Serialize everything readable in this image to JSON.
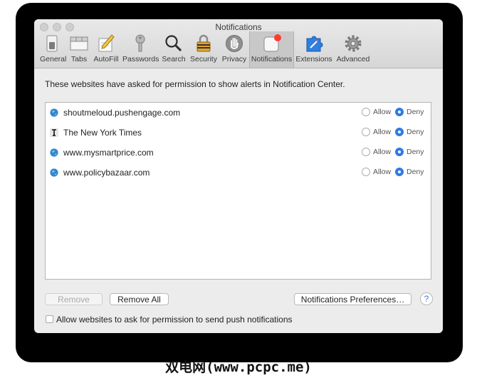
{
  "window": {
    "title": "Notifications"
  },
  "toolbar": {
    "tabs": [
      {
        "label": "General",
        "icon": "general-switch-icon"
      },
      {
        "label": "Tabs",
        "icon": "tabs-icon"
      },
      {
        "label": "AutoFill",
        "icon": "pencil-icon"
      },
      {
        "label": "Passwords",
        "icon": "key-icon"
      },
      {
        "label": "Search",
        "icon": "magnifier-icon"
      },
      {
        "label": "Security",
        "icon": "padlock-icon"
      },
      {
        "label": "Privacy",
        "icon": "hand-icon"
      },
      {
        "label": "Notifications",
        "icon": "notification-badge-icon",
        "active": true
      },
      {
        "label": "Extensions",
        "icon": "puzzle-icon"
      },
      {
        "label": "Advanced",
        "icon": "gear-icon"
      }
    ]
  },
  "description": "These websites have asked for permission to show alerts in Notification Center.",
  "sites": [
    {
      "name": "shoutmeloud.pushengage.com",
      "icon": "globe-icon",
      "allow_label": "Allow",
      "deny_label": "Deny",
      "selected": "Deny"
    },
    {
      "name": "The New York Times",
      "icon": "nyt-logo-icon",
      "allow_label": "Allow",
      "deny_label": "Deny",
      "selected": "Deny"
    },
    {
      "name": "www.mysmartprice.com",
      "icon": "globe-icon",
      "allow_label": "Allow",
      "deny_label": "Deny",
      "selected": "Deny"
    },
    {
      "name": "www.policybazaar.com",
      "icon": "globe-icon",
      "allow_label": "Allow",
      "deny_label": "Deny",
      "selected": "Deny"
    }
  ],
  "buttons": {
    "remove": "Remove",
    "remove_all": "Remove All",
    "preferences": "Notifications Preferences…",
    "help": "?"
  },
  "checkbox": {
    "label": "Allow websites to ask for permission to send push notifications",
    "checked": false
  },
  "watermark": "双电网(www.pcpc.me)",
  "colors": {
    "accent": "#2f7ae6",
    "badge": "#ff3b30"
  }
}
